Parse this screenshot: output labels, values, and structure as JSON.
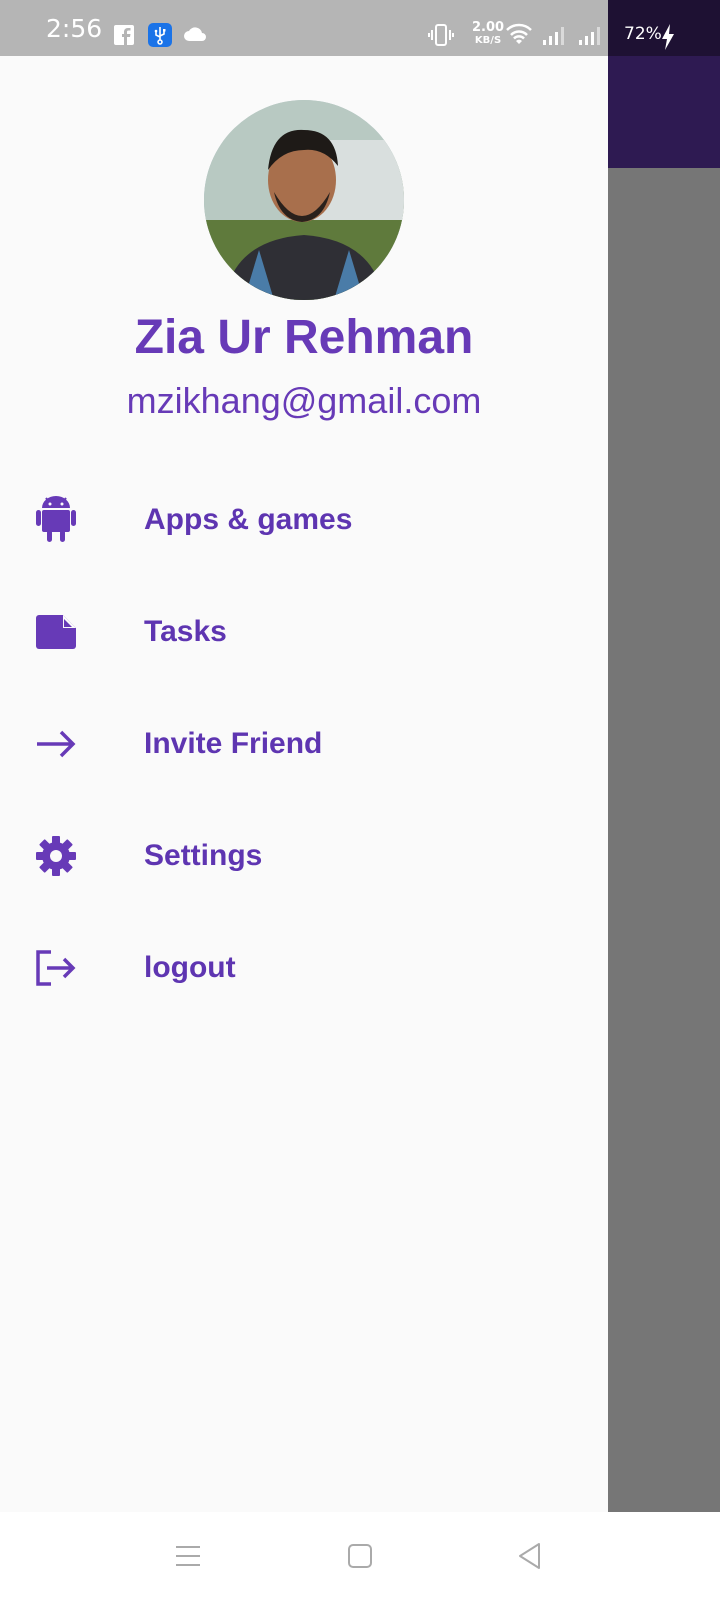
{
  "status_bar": {
    "time": "2:56",
    "net_speed_value": "2.00",
    "net_speed_unit": "KB/S",
    "battery": "72%"
  },
  "drawer": {
    "user": {
      "name": "Zia Ur Rehman",
      "email": "mzikhang@gmail.com"
    },
    "menu": [
      {
        "label": "Apps & games",
        "icon": "android-icon"
      },
      {
        "label": "Tasks",
        "icon": "note-icon"
      },
      {
        "label": "Invite Friend",
        "icon": "arrow-right-icon"
      },
      {
        "label": "Settings",
        "icon": "gear-icon"
      },
      {
        "label": "logout",
        "icon": "logout-icon"
      }
    ]
  },
  "colors": {
    "accent": "#673ab7",
    "drawer_bg": "#fafafa",
    "scrim": "#777777",
    "app_bar": "#2e1a52"
  },
  "nav_bar": {
    "buttons": [
      "menu-icon",
      "home-icon",
      "back-icon"
    ]
  }
}
